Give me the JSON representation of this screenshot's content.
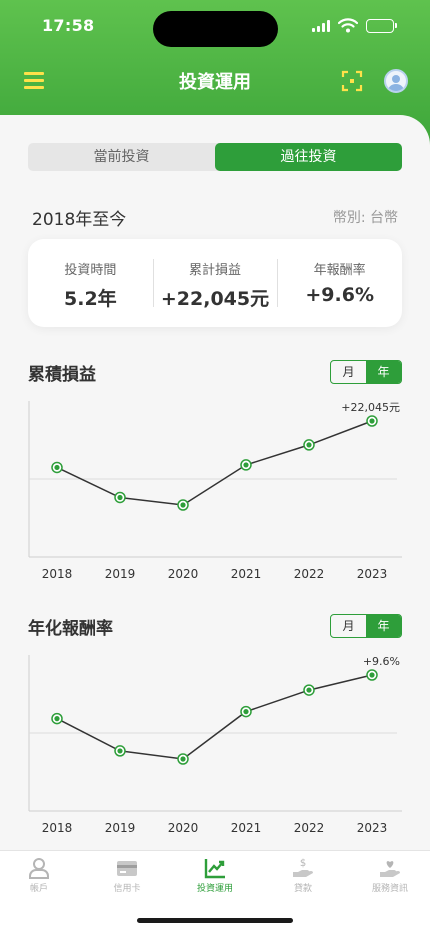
{
  "status": {
    "time": "17:58"
  },
  "header": {
    "title": "投資運用"
  },
  "segment": {
    "current": "當前投資",
    "past": "過往投資",
    "active": "past"
  },
  "period": {
    "label": "2018年至今",
    "currency": "幣別: 台幣"
  },
  "summary": [
    {
      "label": "投資時間",
      "value": "5.2年"
    },
    {
      "label": "累計損益",
      "value": "+22,045元"
    },
    {
      "label": "年報酬率",
      "value": "+9.6%"
    }
  ],
  "charts": {
    "profit": {
      "title": "累積損益",
      "toggle_month": "月",
      "toggle_year": "年",
      "active": "year"
    },
    "return": {
      "title": "年化報酬率",
      "toggle_month": "月",
      "toggle_year": "年",
      "active": "year"
    }
  },
  "chart_data": [
    {
      "type": "line",
      "title": "累積損益",
      "categories": [
        "2018",
        "2019",
        "2020",
        "2021",
        "2022",
        "2023"
      ],
      "values": [
        3500,
        -8500,
        -11500,
        4500,
        12500,
        22045
      ],
      "annotations": [
        "+22,045元"
      ],
      "grid": "single horizontal midline",
      "color": "#2e9e3a"
    },
    {
      "type": "line",
      "title": "年化報酬率",
      "categories": [
        "2018",
        "2019",
        "2020",
        "2021",
        "2022",
        "2023"
      ],
      "values": [
        1.5,
        -4.5,
        -6.0,
        2.8,
        6.8,
        9.6
      ],
      "annotations": [
        "+9.6%"
      ],
      "grid": "single horizontal midline",
      "color": "#2e9e3a"
    }
  ],
  "tabs": [
    {
      "label": "帳戶",
      "icon": "person-icon"
    },
    {
      "label": "信用卡",
      "icon": "credit-card-icon"
    },
    {
      "label": "投資運用",
      "icon": "investment-chart-icon",
      "active": true
    },
    {
      "label": "貸款",
      "icon": "loan-hand-icon"
    },
    {
      "label": "服務資訊",
      "icon": "service-heart-icon"
    }
  ],
  "colors": {
    "brand": "#2e9e3a",
    "header_top": "#5fc24e",
    "header_bottom": "#3aa338",
    "menu_icon": "#ffe14a"
  }
}
